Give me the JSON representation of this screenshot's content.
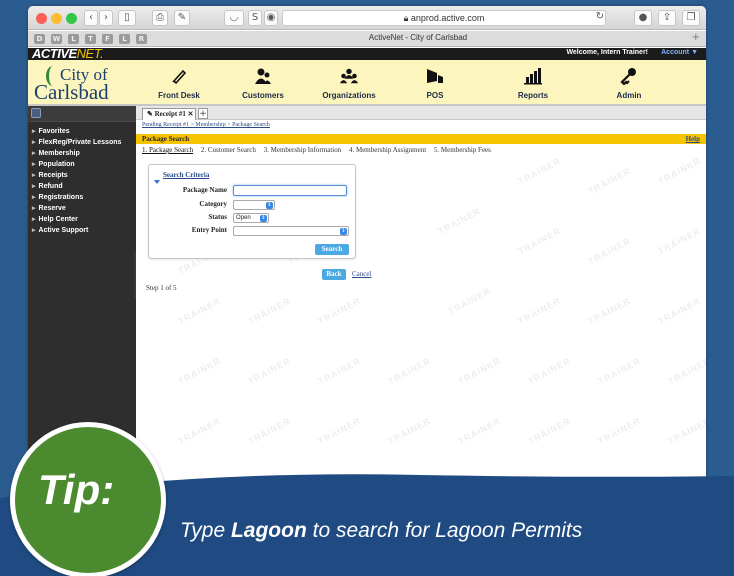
{
  "browser": {
    "url": "anprod.active.com",
    "tab_title": "ActiveNet - City of Carlsbad"
  },
  "banner": {
    "logo_active": "ACTIVE",
    "logo_net": "NET.",
    "welcome": "Welcome, Intern Trainer!",
    "account": "Account ▼"
  },
  "city": {
    "line1": "City of",
    "line2": "Carlsbad"
  },
  "nav": [
    {
      "label": "Front Desk",
      "icon": "pencil-icon"
    },
    {
      "label": "Customers",
      "icon": "customers-icon"
    },
    {
      "label": "Organizations",
      "icon": "organizations-icon"
    },
    {
      "label": "POS",
      "icon": "pos-icon"
    },
    {
      "label": "Reports",
      "icon": "reports-icon"
    },
    {
      "label": "Admin",
      "icon": "admin-key-icon"
    }
  ],
  "sidebar": {
    "items": [
      {
        "label": "Favorites"
      },
      {
        "label": "FlexReg/Private Lessons"
      },
      {
        "label": "Membership"
      },
      {
        "label": "Population"
      },
      {
        "label": "Receipts"
      },
      {
        "label": "Refund"
      },
      {
        "label": "Registrations"
      },
      {
        "label": "Reserve"
      },
      {
        "label": "Help Center"
      },
      {
        "label": "Active Support"
      }
    ]
  },
  "receipt_tab": {
    "label": "Receipt #1 ✕",
    "add": "+"
  },
  "breadcrumb": "Pending Receipt #1 > Membership > Package Search",
  "section": {
    "title": "Package Search",
    "help": "Help"
  },
  "steps": [
    "1. Package Search",
    "2. Customer Search",
    "3. Membership Information",
    "4. Membership Assignment",
    "5. Membership Fees"
  ],
  "criteria": {
    "heading": "Search Criteria",
    "package_name_label": "Package Name",
    "package_name_value": "",
    "category_label": "Category",
    "category_value": "",
    "status_label": "Status",
    "status_value": "Open",
    "entry_point_label": "Entry Point",
    "entry_point_value": "",
    "search_button": "Search"
  },
  "footer_actions": {
    "back": "Back",
    "cancel": "Cancel",
    "step_count": "Step 1 of 5"
  },
  "watermark": "TRAINER",
  "tip": {
    "badge": "Tip:",
    "pre": "Type ",
    "keyword": "Lagoon",
    "post": " to search for Lagoon Permits"
  },
  "colors": {
    "nav_bg": "#fcf5bd",
    "section_bar": "#f6c400",
    "sidebar_bg": "#2e2e2e",
    "button_blue": "#4aa9e3",
    "tip_green": "#4b8a2e",
    "tip_blue": "#1f4b82"
  }
}
